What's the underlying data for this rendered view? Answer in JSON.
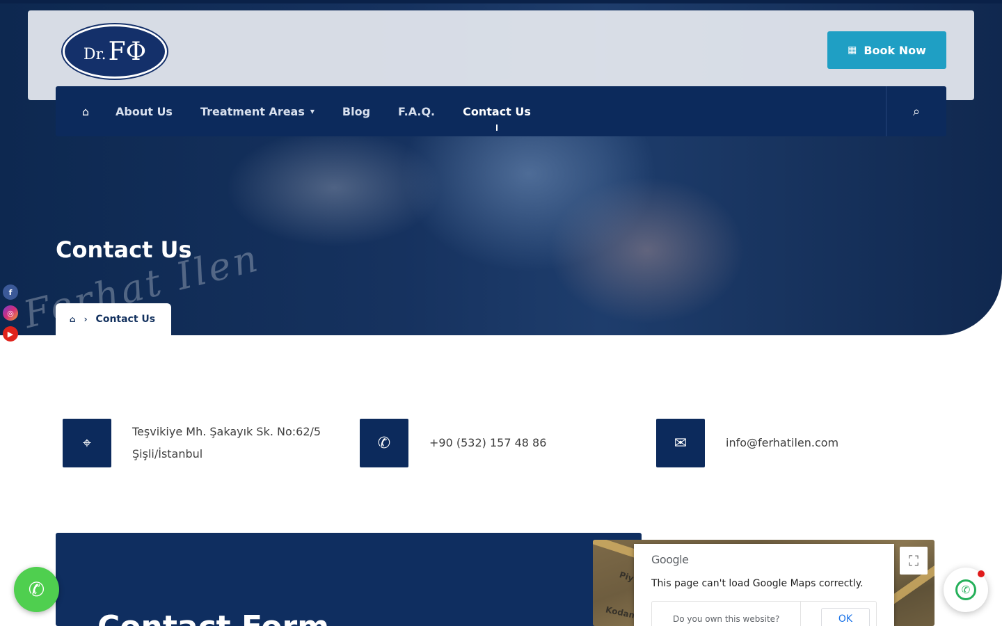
{
  "header": {
    "logo": {
      "prefix": "Dr.",
      "mark": "FΦ"
    },
    "book_button": {
      "label": "Book Now",
      "icon": "calendar-icon"
    }
  },
  "nav": {
    "home_icon": "home-icon",
    "items": [
      {
        "label": "About Us"
      },
      {
        "label": "Treatment Areas",
        "has_submenu": true
      },
      {
        "label": "Blog"
      },
      {
        "label": "F.A.Q."
      },
      {
        "label": "Contact Us",
        "active": true
      }
    ],
    "search_icon": "search-icon"
  },
  "hero": {
    "title": "Contact Us",
    "signature": "Ferhat İlen",
    "breadcrumb": {
      "current": "Contact Us"
    }
  },
  "social": [
    "f",
    "◎",
    "▶"
  ],
  "contact": {
    "address": {
      "line1": "Teşvikiye Mh. Şakayık Sk. No:62/5",
      "line2": "Şişli/İstanbul"
    },
    "phone": "+90 (532) 157 48 86",
    "email": "info@ferhatilen.com"
  },
  "form": {
    "title": "Contact Form"
  },
  "map": {
    "labels": [
      "Piy",
      "Kodam"
    ],
    "dialog": {
      "brand": "Google",
      "message": "This page can't load Google Maps correctly.",
      "question": "Do you own this website?",
      "ok": "OK"
    }
  },
  "colors": {
    "navy": "#0c2a5c",
    "accent": "#1f9fc4",
    "whatsapp": "#25b05a",
    "phone": "#4fcf4f"
  }
}
